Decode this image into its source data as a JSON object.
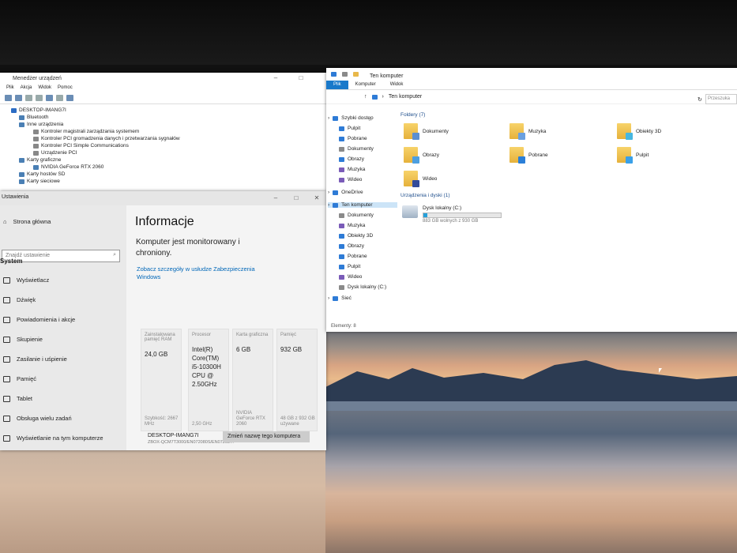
{
  "device_manager": {
    "title": "Menedżer urządzeń",
    "menu": [
      "Plik",
      "Akcja",
      "Widok",
      "Pomoc"
    ],
    "tree": [
      {
        "label": "DESKTOP-IMANG7I",
        "level": 0,
        "icon": "computer-icon"
      },
      {
        "label": "Bluetooth",
        "level": 1,
        "icon": "bluetooth-icon"
      },
      {
        "label": "Inne urządzenia",
        "level": 1,
        "icon": "device-icon"
      },
      {
        "label": "Kontroler magistrali zarządzania systemem",
        "level": 2,
        "icon": "warning-device-icon"
      },
      {
        "label": "Kontroler PCI gromadzenia danych i przetwarzania sygnałów",
        "level": 2,
        "icon": "warning-device-icon"
      },
      {
        "label": "Kontroler PCI Simple Communications",
        "level": 2,
        "icon": "warning-device-icon"
      },
      {
        "label": "Urządzenie PCI",
        "level": 2,
        "icon": "warning-device-icon"
      },
      {
        "label": "Karty graficzne",
        "level": 1,
        "icon": "display-adapter-icon"
      },
      {
        "label": "NVIDIA GeForce RTX 2060",
        "level": 2,
        "icon": "display-adapter-icon"
      },
      {
        "label": "Karty hostów SD",
        "level": 1,
        "icon": "sd-host-icon"
      },
      {
        "label": "Karty sieciowe",
        "level": 1,
        "icon": "network-adapter-icon"
      }
    ]
  },
  "settings": {
    "title": "Ustawienia",
    "home": "Strona główna",
    "search_placeholder": "Znajdź ustawienie",
    "section": "System",
    "nav": [
      "Wyświetlacz",
      "Dźwięk",
      "Powiadomienia i akcje",
      "Skupienie",
      "Zasilanie i uśpienie",
      "Pamięć",
      "Tablet",
      "Obsługa wielu zadań",
      "Wyświetlanie na tym komputerze"
    ],
    "heading": "Informacje",
    "protected_text": "Komputer jest monitorowany i chroniony.",
    "security_link": "Zobacz szczegóły w usłudze Zabezpieczenia Windows",
    "cards": [
      {
        "label": "Zainstalowana pamięć RAM",
        "value": "24,0 GB",
        "sub": "Szybkość: 2667 MHz"
      },
      {
        "label": "Procesor",
        "value": "Intel(R) Core(TM) i5-10300H CPU @ 2.50GHz",
        "sub": "2,50 GHz"
      },
      {
        "label": "Karta graficzna",
        "value": "6 GB",
        "sub": "NVIDIA GeForce RTX 2060"
      },
      {
        "label": "Pamięć",
        "value": "932 GB",
        "sub": "48 GB z 932 GB używane"
      }
    ],
    "device_name": "DESKTOP-IMANG7I",
    "device_model": "ZBOX-QCM7T3000/EN072080S/EN07208…",
    "rename_button": "Zmień nazwę tego komputera"
  },
  "explorer": {
    "title": "Ten komputer",
    "tabs": [
      "Plik",
      "Komputer",
      "Widok"
    ],
    "address": "Ten komputer",
    "search_placeholder": "Przeszuka",
    "nav": [
      {
        "label": "Szybki dostęp",
        "icon": "star-icon",
        "level": 0
      },
      {
        "label": "Pulpit",
        "icon": "desktop-icon",
        "level": 1
      },
      {
        "label": "Pobrane",
        "icon": "download-icon",
        "level": 1
      },
      {
        "label": "Dokumenty",
        "icon": "documents-icon",
        "level": 1
      },
      {
        "label": "Obrazy",
        "icon": "pictures-icon",
        "level": 1
      },
      {
        "label": "Muzyka",
        "icon": "music-icon",
        "level": 1
      },
      {
        "label": "Wideo",
        "icon": "video-icon",
        "level": 1
      },
      {
        "label": "OneDrive",
        "icon": "cloud-icon",
        "level": 0
      },
      {
        "label": "Ten komputer",
        "icon": "computer-icon",
        "level": 0
      },
      {
        "label": "Dokumenty",
        "icon": "documents-icon",
        "level": 1
      },
      {
        "label": "Muzyka",
        "icon": "music-icon",
        "level": 1
      },
      {
        "label": "Obiekty 3D",
        "icon": "objects-3d-icon",
        "level": 1
      },
      {
        "label": "Obrazy",
        "icon": "pictures-icon",
        "level": 1
      },
      {
        "label": "Pobrane",
        "icon": "download-icon",
        "level": 1
      },
      {
        "label": "Pulpit",
        "icon": "desktop-icon",
        "level": 1
      },
      {
        "label": "Wideo",
        "icon": "video-icon",
        "level": 1
      },
      {
        "label": "Dysk lokalny (C:)",
        "icon": "drive-icon",
        "level": 1
      },
      {
        "label": "Sieć",
        "icon": "network-icon",
        "level": 0
      }
    ],
    "folders_header": "Foldery (7)",
    "folders": [
      "Dokumenty",
      "Muzyka",
      "Obiekty 3D",
      "Obrazy",
      "Pobrane",
      "Pulpit",
      "Wideo"
    ],
    "drives_header": "Urządzenia i dyski (1)",
    "drive": {
      "name": "Dysk lokalny (C:)",
      "free": "883 GB wolnych z 930 GB",
      "used_fraction": 0.05
    },
    "status": "Elementy: 8"
  },
  "colors": {
    "accent": "#1979ca",
    "selection": "#cce4f7",
    "link": "#0067b8"
  }
}
